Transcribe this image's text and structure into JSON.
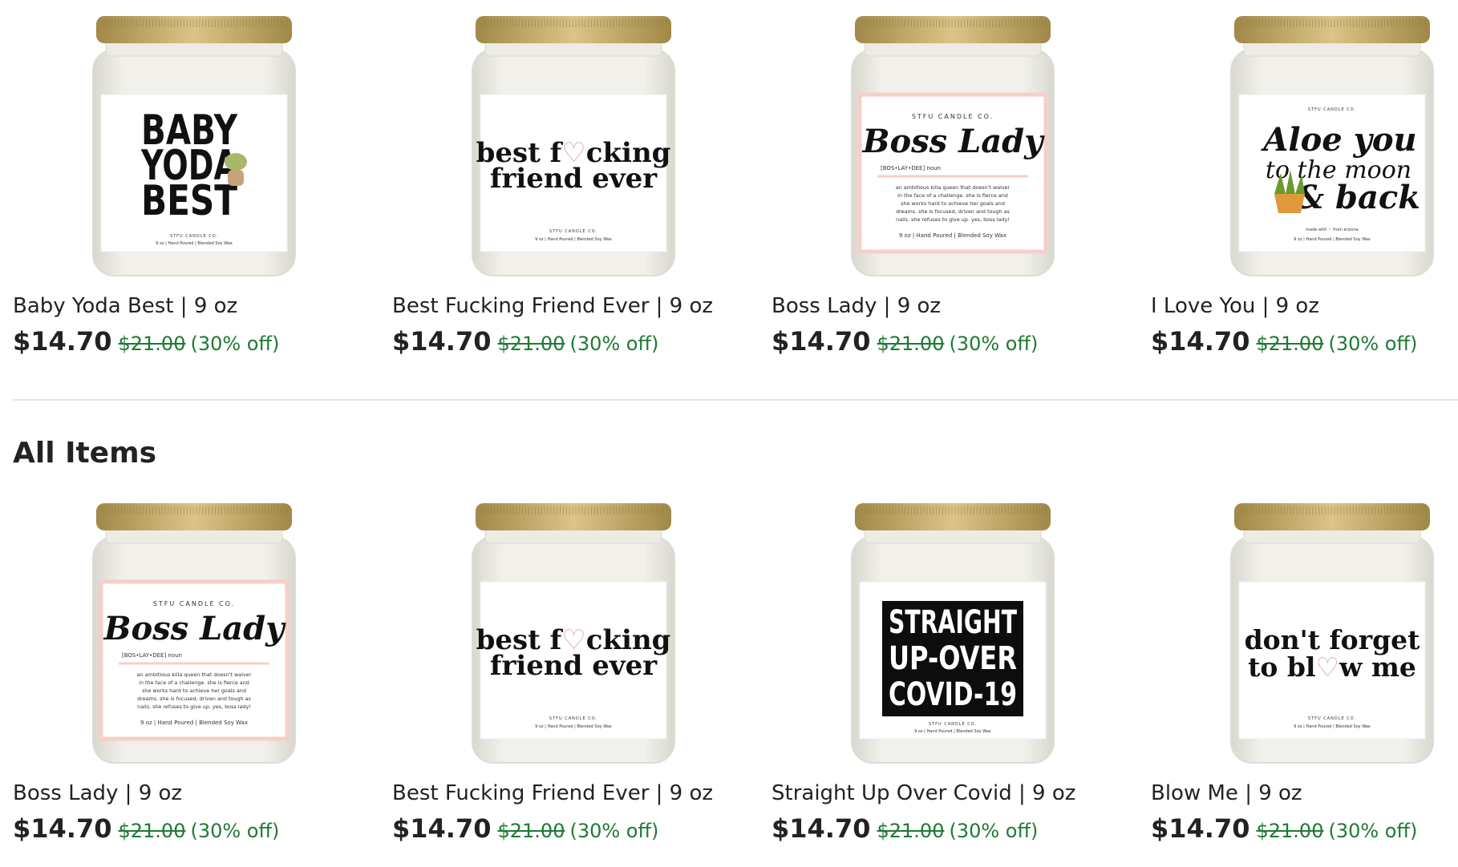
{
  "featured": [
    {
      "title": "Baby Yoda Best | 9 oz",
      "price": "$14.70",
      "original_price": "$21.00",
      "discount": "(30% off)",
      "label": {
        "style": "yoda",
        "lines": [
          "BABY",
          "YODA",
          "BEST"
        ],
        "brand": "STFU CANDLE CO.",
        "footer": "9 oz | Hand Poured | Blended Soy Wax"
      }
    },
    {
      "title": "Best Fucking Friend Ever | 9 oz",
      "price": "$14.70",
      "original_price": "$21.00",
      "discount": "(30% off)",
      "label": {
        "style": "bffe",
        "line1a": "best f",
        "line1b": "cking",
        "line2": "friend ever",
        "brand": "STFU CANDLE CO.",
        "footer": "9 oz | Hand Poured | Blended Soy Wax"
      }
    },
    {
      "title": "Boss Lady | 9 oz",
      "price": "$14.70",
      "original_price": "$21.00",
      "discount": "(30% off)",
      "label": {
        "style": "boss",
        "brand": "STFU CANDLE CO.",
        "script": "Boss Lady",
        "phonetic": "[BOS•LAY•DEE] noun",
        "desc": [
          "an ambitious killa queen that doesn't waiver",
          "in the face of a challenge. she is fierce and",
          "she works hard to achieve her goals and",
          "dreams. she is focused, driven and tough as",
          "nails. she refuses to give up. yes, boss lady!"
        ],
        "footer": "9 oz | Hand Poured | Blended Soy Wax"
      }
    },
    {
      "title": "I Love You | 9 oz",
      "price": "$14.70",
      "original_price": "$21.00",
      "discount": "(30% off)",
      "label": {
        "style": "aloe",
        "brand": "STFU CANDLE CO.",
        "lines": [
          "Aloe you",
          "to the moon",
          "& back"
        ],
        "made": "made with ♡ from arizona",
        "footer": "9 oz | Hand Poured | Blended Soy Wax"
      }
    }
  ],
  "section": {
    "title": "All Items"
  },
  "items": [
    {
      "title": "Boss Lady | 9 oz",
      "price": "$14.70",
      "original_price": "$21.00",
      "discount": "(30% off)",
      "label": {
        "style": "boss",
        "brand": "STFU CANDLE CO.",
        "script": "Boss Lady",
        "phonetic": "[BOS•LAY•DEE] noun",
        "desc": [
          "an ambitious killa queen that doesn't waiver",
          "in the face of a challenge. she is fierce and",
          "she works hard to achieve her goals and",
          "dreams. she is focused, driven and tough as",
          "nails. she refuses to give up. yes, boss lady!"
        ],
        "footer": "9 oz | Hand Poured | Blended Soy Wax"
      }
    },
    {
      "title": "Best Fucking Friend Ever | 9 oz",
      "price": "$14.70",
      "original_price": "$21.00",
      "discount": "(30% off)",
      "label": {
        "style": "bffe",
        "line1a": "best f",
        "line1b": "cking",
        "line2": "friend ever",
        "brand": "STFU CANDLE CO.",
        "footer": "9 oz | Hand Poured | Blended Soy Wax"
      }
    },
    {
      "title": "Straight Up Over Covid | 9 oz",
      "price": "$14.70",
      "original_price": "$21.00",
      "discount": "(30% off)",
      "label": {
        "style": "covid",
        "lines": [
          "STRAIGHT",
          "UP-OVER",
          "COVID-19"
        ],
        "brand": "STFU CANDLE CO.",
        "footer": "9 oz | Hand Poured | Blended Soy Wax"
      }
    },
    {
      "title": "Blow Me | 9 oz",
      "price": "$14.70",
      "original_price": "$21.00",
      "discount": "(30% off)",
      "label": {
        "style": "blow",
        "line1": "don't forget",
        "line2a": "to bl",
        "line2b": "w me",
        "brand": "STFU CANDLE CO.",
        "footer": "9 oz | Hand Poured | Blended Soy Wax"
      }
    }
  ],
  "colors": {
    "sale_green": "#1f7a34",
    "lid_gold": "#c9ae6a",
    "wax": "#f1f0ea",
    "pink_border": "#f6cfc8",
    "heart_pink": "#e6a3a8"
  }
}
